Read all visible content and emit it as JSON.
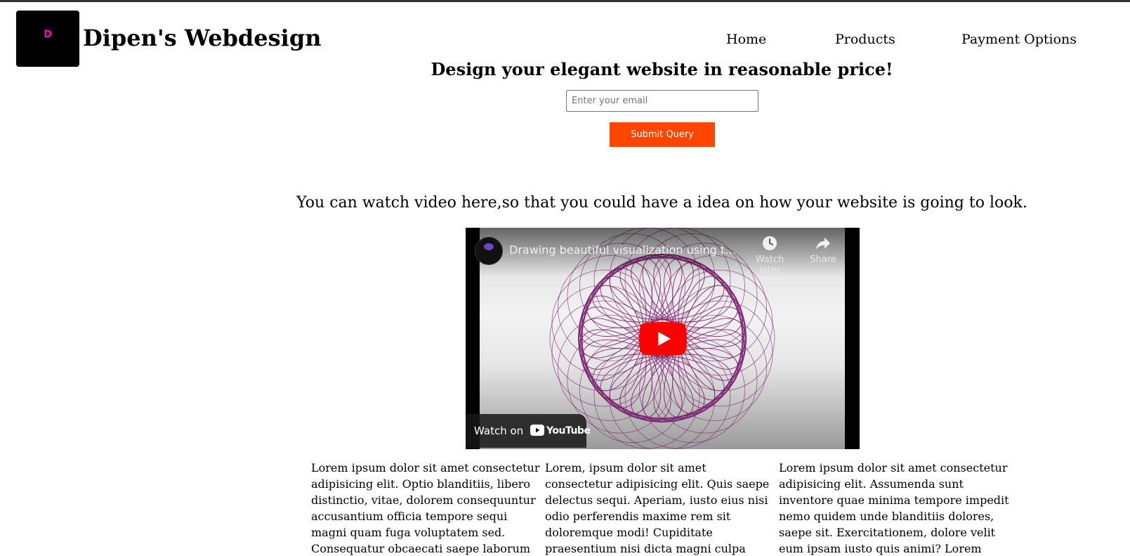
{
  "header": {
    "logo_letter": "D",
    "site_title": "Dipen's Webdesign",
    "nav": [
      {
        "label": "Home"
      },
      {
        "label": "Products"
      },
      {
        "label": "Payment Options"
      }
    ]
  },
  "hero": {
    "headline": "Design your elegant website in reasonable price!",
    "email_placeholder": "Enter your email",
    "email_value": "",
    "submit_label": "Submit Query"
  },
  "video_section": {
    "caption": "You can watch video here,so that you could have a idea on how your website is going to look.",
    "video": {
      "title": "Drawing beautiful visualization using tu...",
      "watch_later_label": "Watch later",
      "share_label": "Share",
      "watch_on_label": "Watch on",
      "youtube_label": "YouTube"
    }
  },
  "columns": [
    {
      "text": "Lorem ipsum dolor sit amet consectetur adipisicing elit. Optio blanditiis, libero distinctio, vitae, dolorem consequuntur accusantium officia tempore sequi magni quam fuga voluptatem sed. Consequatur obcaecati saepe laborum rerum cupiditate."
    },
    {
      "text": "Lorem, ipsum dolor sit amet consectetur adipisicing elit. Quis saepe delectus sequi. Aperiam, iusto eius nisi odio perferendis maxime rem sit doloremque modi! Cupiditate praesentium nisi dicta magni culpa esse. Lorem ipsum dolor sit amet"
    },
    {
      "text": "Lorem ipsum dolor sit amet consectetur adipisicing elit. Assumenda sunt inventore quae minima tempore impedit nemo quidem unde blanditiis dolores, saepe sit. Exercitationem, dolore velit eum ipsam iusto quis animi? Lorem ipsum dolor sit"
    }
  ],
  "colors": {
    "accent": "#ff4500",
    "logo_letter": "#ff00d4",
    "spiro_line": "#7a1f6e",
    "youtube_red": "#ff0000"
  }
}
